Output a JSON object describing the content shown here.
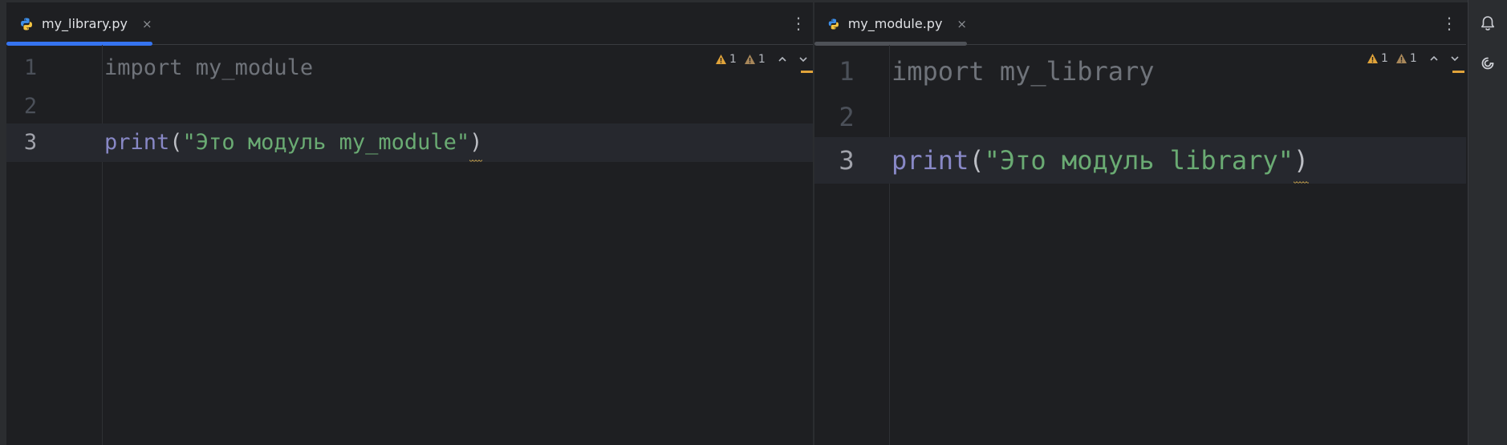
{
  "colors": {
    "editor_bg": "#1e1f22",
    "toolbar_bg": "#2b2d30",
    "current_line_bg": "#26282e",
    "active_tab_accent": "#3574f0",
    "inactive_tab_accent": "#4e5157",
    "keyword_import": "#6f737a",
    "builtin_print": "#8888c6",
    "string": "#6aab73",
    "warning": "#e0a33a"
  },
  "left_pane": {
    "tab": {
      "label": "my_library.py",
      "close": "×",
      "icon": "python-file-icon",
      "active": true
    },
    "menu_glyph": "⋮",
    "inspections": {
      "warning_count": "1",
      "weak_warning_count": "1"
    },
    "lines": [
      {
        "number": "1",
        "import_kw": "import",
        "rest": " my_module"
      },
      {
        "number": "2"
      },
      {
        "number": "3",
        "func": "print",
        "open": "(",
        "string": "\"Это модуль my_module\"",
        "close": ")"
      }
    ]
  },
  "right_pane": {
    "tab": {
      "label": "my_module.py",
      "close": "×",
      "icon": "python-file-icon",
      "active": false
    },
    "menu_glyph": "⋮",
    "inspections": {
      "warning_count": "1",
      "weak_warning_count": "1"
    },
    "lines": [
      {
        "number": "1",
        "import_kw": "import",
        "rest": " my_library"
      },
      {
        "number": "2"
      },
      {
        "number": "3",
        "func": "print",
        "open": "(",
        "string": "\"Это модуль library\"",
        "close": ")"
      }
    ]
  },
  "right_toolbar": {
    "items": [
      "notifications-bell-icon",
      "ai-assistant-spiral-icon"
    ]
  }
}
